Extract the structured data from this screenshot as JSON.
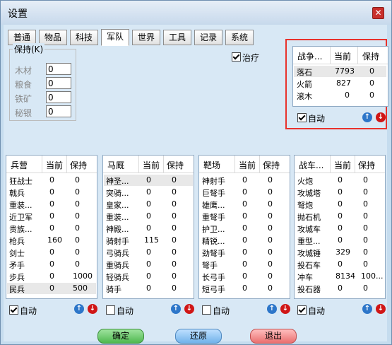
{
  "window": {
    "title": "设置"
  },
  "tabs": [
    "普通",
    "物品",
    "科技",
    "军队",
    "世界",
    "工具",
    "记录",
    "系统"
  ],
  "active_tab": "军队",
  "hold_group": {
    "title": "保持(K)",
    "items": [
      {
        "label": "木材",
        "value": "0"
      },
      {
        "label": "粮食",
        "value": "0"
      },
      {
        "label": "铁矿",
        "value": "0"
      },
      {
        "label": "秘银",
        "value": "0"
      }
    ]
  },
  "heal": {
    "label": "治疗",
    "checked": true
  },
  "war_box": {
    "headers": [
      "战争...",
      "当前",
      "保持"
    ],
    "rows": [
      [
        "落石",
        "7793",
        "0"
      ],
      [
        "火箭",
        "827",
        "0"
      ],
      [
        "滚木",
        "0",
        "0"
      ]
    ],
    "auto": "自动"
  },
  "tables": [
    {
      "headers": [
        "兵营",
        "当前",
        "保持"
      ],
      "rows": [
        [
          "狂战士",
          "0",
          "0"
        ],
        [
          "戟兵",
          "0",
          "0"
        ],
        [
          "重装...",
          "0",
          "0"
        ],
        [
          "近卫军",
          "0",
          "0"
        ],
        [
          "贵族...",
          "0",
          "0"
        ],
        [
          "枪兵",
          "160",
          "0"
        ],
        [
          "剑士",
          "0",
          "0"
        ],
        [
          "矛手",
          "0",
          "0"
        ],
        [
          "步兵",
          "0",
          "1000"
        ],
        [
          "民兵",
          "0",
          "500"
        ]
      ],
      "auto": "自动",
      "auto_checked": true
    },
    {
      "headers": [
        "马厩",
        "当前",
        "保持"
      ],
      "rows": [
        [
          "神圣...",
          "0",
          "0"
        ],
        [
          "突骑...",
          "0",
          "0"
        ],
        [
          "皇家...",
          "0",
          "0"
        ],
        [
          "重装...",
          "0",
          "0"
        ],
        [
          "神殿...",
          "0",
          "0"
        ],
        [
          "骑射手",
          "115",
          "0"
        ],
        [
          "弓骑兵",
          "0",
          "0"
        ],
        [
          "重骑兵",
          "0",
          "0"
        ],
        [
          "轻骑兵",
          "0",
          "0"
        ],
        [
          "骑手",
          "0",
          "0"
        ]
      ],
      "auto": "自动",
      "auto_checked": false
    },
    {
      "headers": [
        "靶场",
        "当前",
        "保持"
      ],
      "rows": [
        [
          "神射手",
          "0",
          "0"
        ],
        [
          "巨弩手",
          "0",
          "0"
        ],
        [
          "雄鹰...",
          "0",
          "0"
        ],
        [
          "重弩手",
          "0",
          "0"
        ],
        [
          "护卫...",
          "0",
          "0"
        ],
        [
          "精锐...",
          "0",
          "0"
        ],
        [
          "劲弩手",
          "0",
          "0"
        ],
        [
          "弩手",
          "0",
          "0"
        ],
        [
          "长弓手",
          "0",
          "0"
        ],
        [
          "短弓手",
          "0",
          "0"
        ]
      ],
      "auto": "自动",
      "auto_checked": false
    },
    {
      "headers": [
        "战车...",
        "当前",
        "保持"
      ],
      "rows": [
        [
          "火炮",
          "0",
          "0"
        ],
        [
          "攻城塔",
          "0",
          "0"
        ],
        [
          "弩炮",
          "0",
          "0"
        ],
        [
          "抛石机",
          "0",
          "0"
        ],
        [
          "攻城车",
          "0",
          "0"
        ],
        [
          "重型...",
          "0",
          "0"
        ],
        [
          "攻城锤",
          "329",
          "0"
        ],
        [
          "投石车",
          "0",
          "0"
        ],
        [
          "冲车",
          "8134",
          "100..."
        ],
        [
          "投石器",
          "0",
          "0"
        ]
      ],
      "auto": "自动",
      "auto_checked": true
    }
  ],
  "buttons": {
    "ok": "确定",
    "restore": "还原",
    "exit": "退出"
  },
  "colors": {
    "highlight": "#e8322c",
    "up": "#2d76c9",
    "down": "#d01616"
  }
}
